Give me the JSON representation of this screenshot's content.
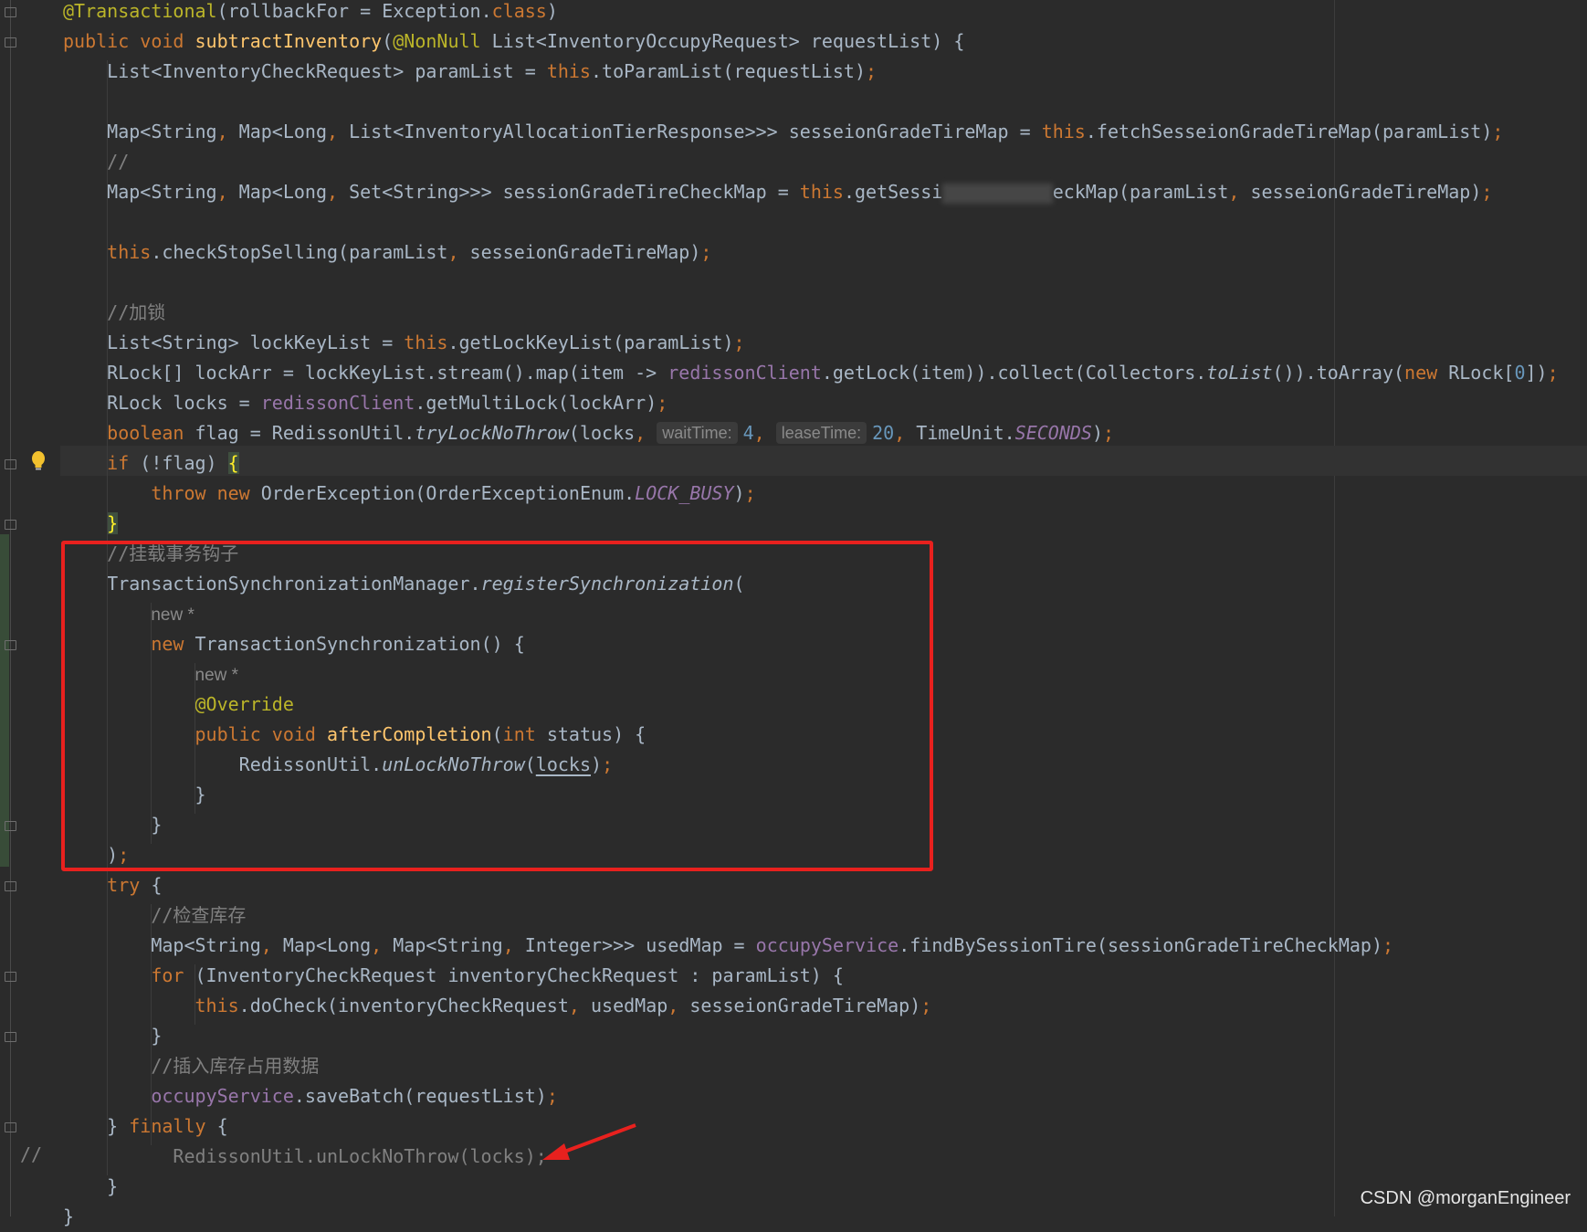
{
  "editor": {
    "lines": [
      {
        "tokens": [
          [
            "an",
            "@Transactional"
          ],
          [
            "",
            "(rollbackFor = Exception."
          ],
          [
            "kw",
            "class"
          ],
          [
            "",
            ")"
          ]
        ]
      },
      {
        "tokens": [
          [
            "kw",
            "public void "
          ],
          [
            "fn",
            "subtractInventory"
          ],
          [
            "",
            "("
          ],
          [
            "an",
            "@NonNull "
          ],
          [
            "",
            "List<InventoryOccupyRequest> requestList) {"
          ]
        ]
      },
      {
        "tokens": [
          [
            "",
            "    List<InventoryCheckRequest> paramList = "
          ],
          [
            "kw",
            "this"
          ],
          [
            "",
            ".toParamList(requestList)"
          ],
          [
            "kw",
            ";"
          ]
        ]
      },
      {
        "tokens": []
      },
      {
        "tokens": [
          [
            "",
            "    Map<String"
          ],
          [
            "kw",
            ", "
          ],
          [
            "",
            "Map<Long"
          ],
          [
            "kw",
            ", "
          ],
          [
            "",
            "List<InventoryAllocationTierResponse>>> sesseionGradeTireMap = "
          ],
          [
            "kw",
            "this"
          ],
          [
            "",
            ".fetchSesseionGradeTireMap(paramList)"
          ],
          [
            "kw",
            ";"
          ]
        ]
      },
      {
        "tokens": [
          [
            "cmk",
            "    //"
          ]
        ]
      },
      {
        "tokens": [
          [
            "",
            "    Map<String"
          ],
          [
            "kw",
            ", "
          ],
          [
            "",
            "Map<Long"
          ],
          [
            "kw",
            ", "
          ],
          [
            "",
            "Set<String>>> sessionGradeTireCheckMap = "
          ],
          [
            "kw",
            "this"
          ],
          [
            "",
            ".getSessi"
          ],
          [
            "blur",
            "          "
          ],
          [
            "",
            "eckMap(paramList"
          ],
          [
            "kw",
            ", "
          ],
          [
            "",
            "sesseionGradeTireMap)"
          ],
          [
            "kw",
            ";"
          ]
        ]
      },
      {
        "tokens": []
      },
      {
        "tokens": [
          [
            "kw",
            "    this"
          ],
          [
            "",
            ".checkStopSelling(paramList"
          ],
          [
            "kw",
            ", "
          ],
          [
            "",
            "sesseionGradeTireMap)"
          ],
          [
            "kw",
            ";"
          ]
        ]
      },
      {
        "tokens": []
      },
      {
        "tokens": [
          [
            "cmk",
            "    //"
          ],
          [
            "cm",
            "加锁"
          ]
        ]
      },
      {
        "tokens": [
          [
            "",
            "    List<String> lockKeyList = "
          ],
          [
            "kw",
            "this"
          ],
          [
            "",
            ".getLockKeyList(paramList)"
          ],
          [
            "kw",
            ";"
          ]
        ]
      },
      {
        "tokens": [
          [
            "",
            "    RLock[] lockArr = lockKeyList.stream().map(item -> "
          ],
          [
            "fld",
            "redissonClient"
          ],
          [
            "",
            ".getLock(item)).collect(Collectors."
          ],
          [
            "ital",
            "toList"
          ],
          [
            "",
            "()).toArray("
          ],
          [
            "kw",
            "new "
          ],
          [
            "",
            "RLock["
          ],
          [
            "num",
            "0"
          ],
          [
            "",
            "])"
          ],
          [
            "kw",
            ";"
          ]
        ]
      },
      {
        "tokens": [
          [
            "",
            "    RLock locks = "
          ],
          [
            "fld",
            "redissonClient"
          ],
          [
            "",
            ".getMultiLock(lockArr)"
          ],
          [
            "kw",
            ";"
          ]
        ]
      },
      {
        "tokens": [
          [
            "kw",
            "    boolean "
          ],
          [
            "",
            "flag = RedissonUtil."
          ],
          [
            "ital",
            "tryLockNoThrow"
          ],
          [
            "",
            "(locks"
          ],
          [
            "kw",
            ", "
          ],
          [
            "hint",
            "waitTime:"
          ],
          [
            "num",
            "4"
          ],
          [
            "kw",
            ", "
          ],
          [
            "hint",
            "leaseTime:"
          ],
          [
            "num",
            "20"
          ],
          [
            "kw",
            ", "
          ],
          [
            "",
            "TimeUnit."
          ],
          [
            "fldi",
            "SECONDS"
          ],
          [
            "",
            ")"
          ],
          [
            "kw",
            ";"
          ]
        ]
      },
      {
        "tokens": [
          [
            "kw",
            "    if "
          ],
          [
            "",
            "(!flag) "
          ],
          [
            "brace",
            "{"
          ]
        ]
      },
      {
        "tokens": [
          [
            "kw",
            "        throw new "
          ],
          [
            "",
            "OrderException(OrderExceptionEnum."
          ],
          [
            "fldi",
            "LOCK_BUSY"
          ],
          [
            "",
            ")"
          ],
          [
            "kw",
            ";"
          ]
        ]
      },
      {
        "tokens": [
          [
            "",
            "    "
          ],
          [
            "brace",
            "}"
          ]
        ]
      },
      {
        "tokens": [
          [
            "cmk",
            "    //"
          ],
          [
            "cm",
            "挂载事务钩子"
          ]
        ]
      },
      {
        "tokens": [
          [
            "",
            "    TransactionSynchronizationManager."
          ],
          [
            "ital",
            "registerSynchronization"
          ],
          [
            "",
            "("
          ]
        ]
      },
      {
        "tokens": [
          [
            "",
            "        "
          ],
          [
            "newhint",
            "new *"
          ]
        ]
      },
      {
        "tokens": [
          [
            "kw",
            "        new "
          ],
          [
            "",
            "TransactionSynchronization() {"
          ]
        ]
      },
      {
        "tokens": [
          [
            "",
            "            "
          ],
          [
            "newhint",
            "new *"
          ]
        ]
      },
      {
        "tokens": [
          [
            "an",
            "            @Override"
          ]
        ]
      },
      {
        "tokens": [
          [
            "kw",
            "            public void "
          ],
          [
            "fn",
            "afterCompletion"
          ],
          [
            "",
            "("
          ],
          [
            "kw",
            "int "
          ],
          [
            "",
            "status) {"
          ]
        ]
      },
      {
        "tokens": [
          [
            "",
            "                RedissonUtil."
          ],
          [
            "ital",
            "unLockNoThrow"
          ],
          [
            "",
            "("
          ],
          [
            "ul",
            "locks"
          ],
          [
            "",
            ")"
          ],
          [
            "kw",
            ";"
          ]
        ]
      },
      {
        "tokens": [
          [
            "",
            "            }"
          ]
        ]
      },
      {
        "tokens": [
          [
            "",
            "        }"
          ]
        ]
      },
      {
        "tokens": [
          [
            "",
            "    )"
          ],
          [
            "kw",
            ";"
          ]
        ]
      },
      {
        "tokens": [
          [
            "kw",
            "    try "
          ],
          [
            "",
            "{"
          ]
        ]
      },
      {
        "tokens": [
          [
            "cmk",
            "        //"
          ],
          [
            "cm",
            "检查库存"
          ]
        ]
      },
      {
        "tokens": [
          [
            "",
            "        Map<String"
          ],
          [
            "kw",
            ", "
          ],
          [
            "",
            "Map<Long"
          ],
          [
            "kw",
            ", "
          ],
          [
            "",
            "Map<String"
          ],
          [
            "kw",
            ", "
          ],
          [
            "",
            "Integer>>> usedMap = "
          ],
          [
            "fld",
            "occupyService"
          ],
          [
            "",
            ".findBySessionTire(sessionGradeTireCheckMap)"
          ],
          [
            "kw",
            ";"
          ]
        ]
      },
      {
        "tokens": [
          [
            "kw",
            "        for "
          ],
          [
            "",
            "(InventoryCheckRequest inventoryCheckRequest : paramList) {"
          ]
        ]
      },
      {
        "tokens": [
          [
            "kw",
            "            this"
          ],
          [
            "",
            ".doCheck(inventoryCheckRequest"
          ],
          [
            "kw",
            ", "
          ],
          [
            "",
            "usedMap"
          ],
          [
            "kw",
            ", "
          ],
          [
            "",
            "sesseionGradeTireMap)"
          ],
          [
            "kw",
            ";"
          ]
        ]
      },
      {
        "tokens": [
          [
            "",
            "        }"
          ]
        ]
      },
      {
        "tokens": [
          [
            "cmk",
            "        //"
          ],
          [
            "cm",
            "插入库存占用数据"
          ]
        ]
      },
      {
        "tokens": [
          [
            "fld",
            "        occupyService"
          ],
          [
            "",
            ".saveBatch(requestList)"
          ],
          [
            "kw",
            ";"
          ]
        ]
      },
      {
        "tokens": [
          [
            "",
            "    } "
          ],
          [
            "kw",
            "finally "
          ],
          [
            "",
            "{"
          ]
        ]
      },
      {
        "tokens": [
          [
            "cmk",
            "          RedissonUtil.unLockNoThrow(locks);"
          ]
        ]
      },
      {
        "tokens": [
          [
            "",
            "    }"
          ]
        ]
      },
      {
        "tokens": [
          [
            "",
            "}"
          ]
        ]
      }
    ],
    "commented_prefix": "//"
  },
  "watermark": "CSDN @morganEngineer",
  "colors": {
    "background": "#2b2b2b",
    "keyword": "#cc7832",
    "function": "#ffc66d",
    "field": "#9876aa",
    "annotation": "#bbb529",
    "number": "#6897bb",
    "comment": "#808080",
    "highlight_box": "#e8211e"
  }
}
